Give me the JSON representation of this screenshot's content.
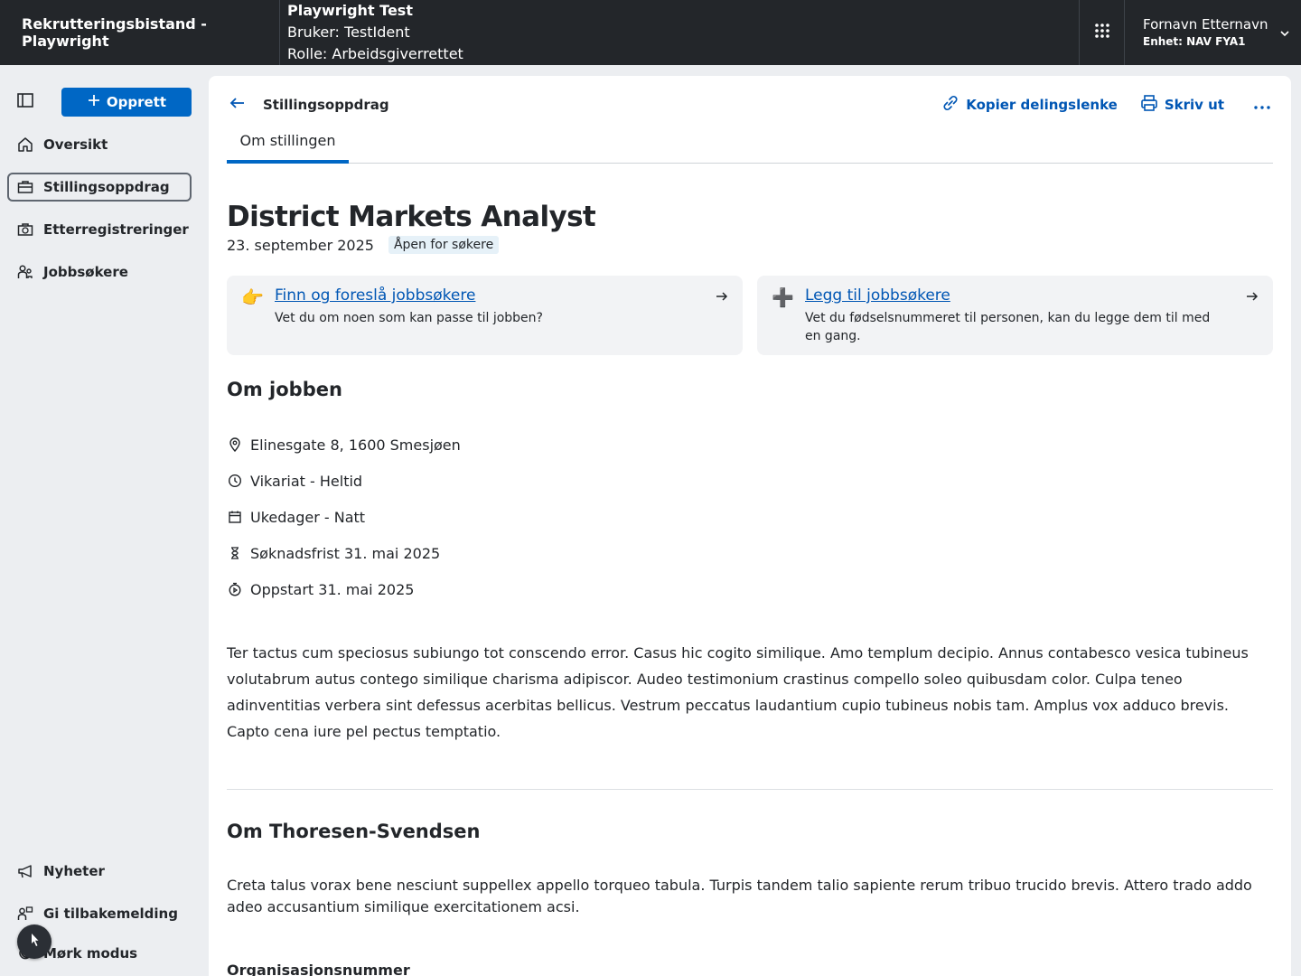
{
  "header": {
    "app_title": "Rekrutteringsbistand - Playwright",
    "env_title": "Playwright Test",
    "env_user": "Bruker: TestIdent",
    "env_role": "Rolle: Arbeidsgiverrettet",
    "user_name": "Fornavn Etternavn",
    "user_unit": "Enhet: NAV FYA1"
  },
  "sidebar": {
    "create_label": "Opprett",
    "items": [
      {
        "label": "Oversikt",
        "icon": "house-icon"
      },
      {
        "label": "Stillingsoppdrag",
        "icon": "briefcase-icon"
      },
      {
        "label": "Etterregistreringer",
        "icon": "briefcase-clock-icon"
      },
      {
        "label": "Jobbsøkere",
        "icon": "people-icon"
      }
    ],
    "bottom_items": [
      {
        "label": "Nyheter",
        "icon": "megaphone-icon"
      },
      {
        "label": "Gi tilbakemelding",
        "icon": "feedback-icon"
      },
      {
        "label": "Mørk modus",
        "icon": "moon-icon"
      }
    ]
  },
  "toolbar": {
    "breadcrumb": "Stillingsoppdrag",
    "copy_link": "Kopier delingslenke",
    "print": "Skriv ut"
  },
  "tabs": [
    {
      "label": "Om stillingen"
    }
  ],
  "job": {
    "title": "District Markets Analyst",
    "date": "23. september 2025",
    "status": "Åpen for søkere"
  },
  "cards": [
    {
      "emoji": "👉",
      "title": "Finn og foreslå jobbsøkere",
      "desc": "Vet du om noen som kan passe til jobben?"
    },
    {
      "emoji": "➕",
      "title": "Legg til jobbsøkere",
      "desc": "Vet du fødselsnummeret til personen, kan du legge dem til med en gang."
    }
  ],
  "about_job": {
    "heading": "Om jobben",
    "facts": [
      {
        "icon": "location-pin-icon",
        "text": "Elinesgate 8, 1600 Smesjøen"
      },
      {
        "icon": "clock-icon",
        "text": "Vikariat - Heltid"
      },
      {
        "icon": "calendar-icon",
        "text": "Ukedager - Natt"
      },
      {
        "icon": "hourglass-icon",
        "text": "Søknadsfrist 31. mai 2025"
      },
      {
        "icon": "stopwatch-icon",
        "text": "Oppstart 31. mai 2025"
      }
    ],
    "description": "Ter tactus cum speciosus subiungo tot conscendo error. Casus hic cogito similique. Amo templum decipio. Annus contabesco vesica tubineus volutabrum autus contego similique charisma adipiscor. Audeo testimonium crastinus compello soleo quibusdam color. Culpa teneo adinventitias verbera sint defessus acerbitas bellicus. Vestrum peccatus laudantium cupio tubineus nobis tam. Amplus vox adduco brevis. Capto cena iure pel pectus temptatio."
  },
  "about_employer": {
    "heading": "Om Thoresen-Svendsen",
    "description": "Creta talus vorax bene nesciunt suppellex appello torqueo tabula. Turpis tandem talio sapiente rerum tribuo trucido brevis. Attero trado addo adeo accusantium similique exercitationem acsi.",
    "org_label": "Organisasjonsnummer"
  },
  "colors": {
    "accent": "#0067c5",
    "header_bg": "#23262a",
    "link": "#0056b4"
  }
}
